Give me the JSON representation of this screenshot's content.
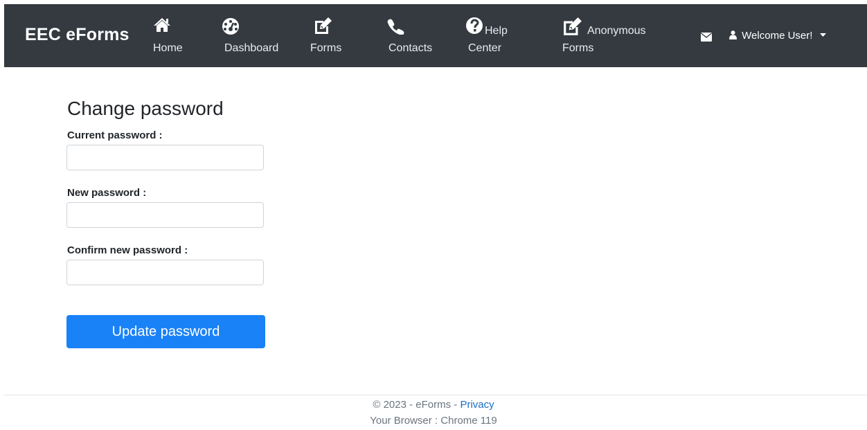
{
  "nav": {
    "brand": "EEC eForms",
    "items": [
      {
        "label_line1": "Home",
        "label_line2": "",
        "icon": "home-icon"
      },
      {
        "label_line1": "Dashboard",
        "label_line2": "",
        "icon": "dashboard-icon"
      },
      {
        "label_line1": "Forms",
        "label_line2": "",
        "icon": "edit-icon"
      },
      {
        "label_line1": "Contacts",
        "label_line2": "",
        "icon": "phone-icon"
      },
      {
        "label_line1": "Help",
        "label_line2": "Center",
        "icon": "question-circle-icon"
      },
      {
        "label_line1": "Anonymous",
        "label_line2": "Forms",
        "icon": "edit-icon"
      }
    ],
    "mail_icon": "envelope-icon",
    "user_label": "Welcome User!",
    "user_icon": "user-icon",
    "dropdown_icon": "caret-down-icon"
  },
  "form": {
    "title": "Change password",
    "current_label": "Current password :",
    "current_value": "",
    "new_label": "New password :",
    "new_value": "",
    "confirm_label": "Confirm new password :",
    "confirm_value": "",
    "submit_label": "Update password"
  },
  "footer": {
    "copyright": "© 2023 - eForms - ",
    "privacy_link": "Privacy",
    "browser": "Your Browser : Chrome 119"
  },
  "colors": {
    "navbar": "#343a40",
    "primary": "#1a82f7",
    "link": "#1b6ec2"
  }
}
